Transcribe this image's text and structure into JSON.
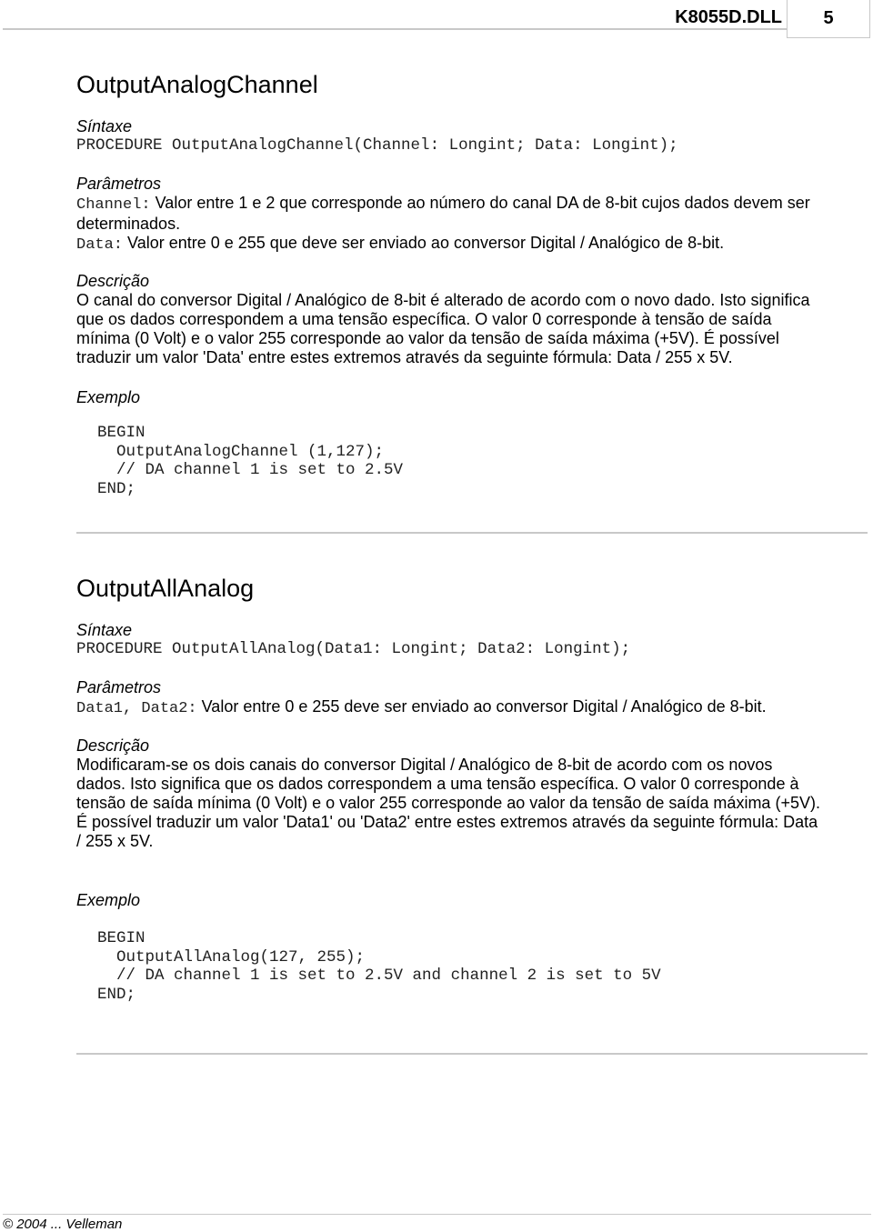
{
  "header": {
    "doc_title": "K8055D.DLL",
    "page_number": "5"
  },
  "sections": [
    {
      "title": "OutputAnalogChannel",
      "syntax_label": "Síntaxe",
      "syntax_code": "PROCEDURE OutputAnalogChannel(Channel: Longint; Data: Longint);",
      "params_label": "Parâmetros",
      "params": [
        {
          "name": "Channel:",
          "desc": "Valor entre 1 e 2 que corresponde ao número do canal DA de 8-bit cujos dados devem ser\ndeterminados."
        },
        {
          "name": "Data:",
          "desc": "Valor entre 0 e 255 que deve ser enviado ao conversor Digital / Analógico de 8-bit."
        }
      ],
      "desc_label": "Descrição",
      "description": "O canal do conversor Digital / Analógico de 8-bit é alterado de acordo com o novo dado. Isto significa\nque os dados correspondem a uma tensão específica. O valor 0 corresponde à tensão de saída\nmínima (0 Volt) e o valor 255 corresponde ao valor da tensão de saída máxima (+5V). É possível\ntraduzir um valor 'Data' entre estes extremos através da seguinte fórmula: Data / 255 x 5V.",
      "example_label": "Exemplo",
      "example_code": "BEGIN\n  OutputAnalogChannel (1,127);\n  // DA channel 1 is set to 2.5V\nEND;"
    },
    {
      "title": "OutputAllAnalog",
      "syntax_label": "Síntaxe",
      "syntax_code": "PROCEDURE OutputAllAnalog(Data1: Longint; Data2: Longint);",
      "params_label": "Parâmetros",
      "params": [
        {
          "name": "Data1, Data2:",
          "desc": "Valor entre 0 e 255 deve ser enviado ao conversor Digital / Analógico de 8-bit."
        }
      ],
      "desc_label": "Descrição",
      "description": "Modificaram-se os dois canais do conversor Digital / Analógico de 8-bit de acordo com os novos\ndados. Isto significa que os dados correspondem a uma tensão específica. O valor 0 corresponde à\ntensão de saída mínima (0 Volt) e o valor 255 corresponde ao valor da tensão de saída máxima (+5V).\nÉ possível traduzir um valor 'Data1' ou 'Data2' entre estes extremos através da seguinte fórmula: Data\n/ 255 x 5V.",
      "example_label": "Exemplo",
      "example_code": "BEGIN\n  OutputAllAnalog(127, 255);\n  // DA channel 1 is set to 2.5V and channel 2 is set to 5V\nEND;"
    }
  ],
  "footer": {
    "copyright": "© 2004 ... Velleman"
  }
}
